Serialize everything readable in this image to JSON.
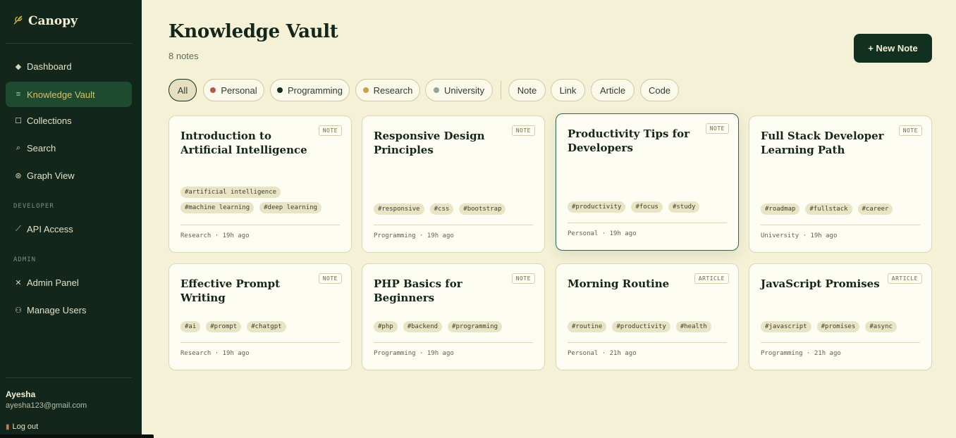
{
  "app": {
    "name": "Canopy",
    "logo_icon": "leaf-icon"
  },
  "sidebar": {
    "main_items": [
      {
        "label": "Dashboard",
        "icon": "diamond-icon",
        "active": false
      },
      {
        "label": "Knowledge Vault",
        "icon": "list-icon",
        "active": true
      },
      {
        "label": "Collections",
        "icon": "square-icon",
        "active": false
      },
      {
        "label": "Search",
        "icon": "search-icon",
        "active": false
      },
      {
        "label": "Graph View",
        "icon": "graph-icon",
        "active": false
      }
    ],
    "developer_section": "DEVELOPER",
    "developer_items": [
      {
        "label": "API Access",
        "icon": "plug-icon"
      }
    ],
    "admin_section": "ADMIN",
    "admin_items": [
      {
        "label": "Admin Panel",
        "icon": "tools-icon"
      },
      {
        "label": "Manage Users",
        "icon": "users-icon"
      }
    ],
    "user": {
      "name": "Ayesha",
      "email": "ayesha123@gmail.com",
      "logout_label": "Log out"
    }
  },
  "header": {
    "title": "Knowledge Vault",
    "count": "8 notes",
    "new_note_label": "+ New Note"
  },
  "filters": {
    "collections": [
      {
        "label": "All",
        "dot": null,
        "active": true
      },
      {
        "label": "Personal",
        "dot": "#b25c4f"
      },
      {
        "label": "Programming",
        "dot": "#12301f"
      },
      {
        "label": "Research",
        "dot": "#c9a44c"
      },
      {
        "label": "University",
        "dot": "#8fa49a"
      }
    ],
    "types": [
      "Note",
      "Link",
      "Article",
      "Code"
    ]
  },
  "notes": [
    {
      "title": "Introduction to Artificial Intelligence",
      "type": "NOTE",
      "tags": [
        "#artificial intelligence",
        "#machine learning",
        "#deep learning"
      ],
      "collection": "Research",
      "time": "19h ago"
    },
    {
      "title": "Responsive Design Principles",
      "type": "NOTE",
      "tags": [
        "#responsive",
        "#css",
        "#bootstrap"
      ],
      "collection": "Programming",
      "time": "19h ago"
    },
    {
      "title": "Productivity Tips for Developers",
      "type": "NOTE",
      "tags": [
        "#productivity",
        "#focus",
        "#study"
      ],
      "collection": "Personal",
      "time": "19h ago"
    },
    {
      "title": "Full Stack Developer Learning Path",
      "type": "NOTE",
      "tags": [
        "#roadmap",
        "#fullstack",
        "#career"
      ],
      "collection": "University",
      "time": "19h ago"
    },
    {
      "title": "Effective Prompt Writing",
      "type": "NOTE",
      "tags": [
        "#ai",
        "#prompt",
        "#chatgpt"
      ],
      "collection": "Research",
      "time": "19h ago"
    },
    {
      "title": "PHP Basics for Beginners",
      "type": "NOTE",
      "tags": [
        "#php",
        "#backend",
        "#programming"
      ],
      "collection": "Programming",
      "time": "19h ago"
    },
    {
      "title": "Morning Routine",
      "type": "ARTICLE",
      "tags": [
        "#routine",
        "#productivity",
        "#health"
      ],
      "collection": "Personal",
      "time": "21h ago"
    },
    {
      "title": "JavaScript Promises",
      "type": "ARTICLE",
      "tags": [
        "#javascript",
        "#promises",
        "#async"
      ],
      "collection": "Programming",
      "time": "21h ago"
    }
  ]
}
